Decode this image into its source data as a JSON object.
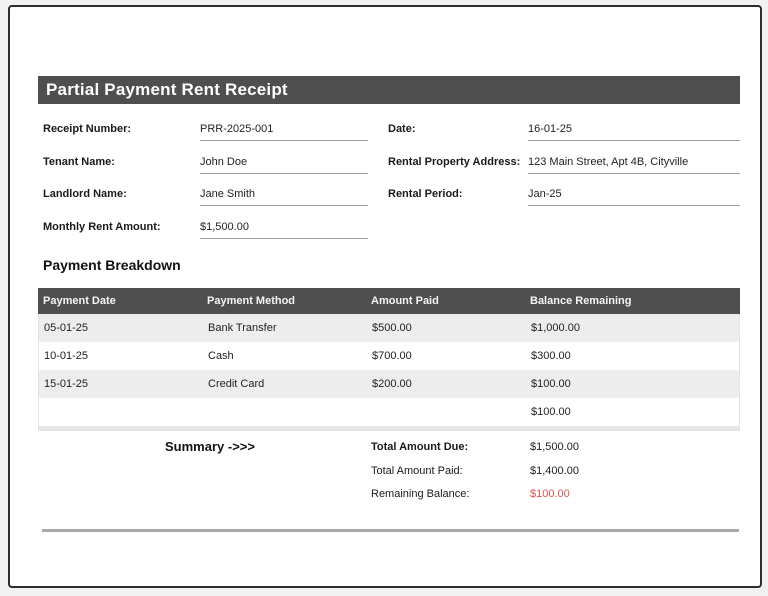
{
  "page": {
    "title": "Partial Payment Rent Receipt"
  },
  "fields": {
    "left": [
      {
        "label": "Receipt Number:",
        "value": "PRR-2025-001"
      },
      {
        "label": "Tenant Name:",
        "value": "John Doe"
      },
      {
        "label": "Landlord Name:",
        "value": "Jane Smith"
      },
      {
        "label": "Monthly Rent Amount:",
        "value": "$1,500.00"
      }
    ],
    "right": [
      {
        "label": "Date:",
        "value": "16-01-25"
      },
      {
        "label": "Rental Property Address:",
        "value": "123 Main Street, Apt 4B, Cityville"
      },
      {
        "label": "Rental Period:",
        "value": "Jan-25"
      }
    ]
  },
  "breakdown": {
    "heading": "Payment Breakdown",
    "columns": [
      "Payment Date",
      "Payment Method",
      "Amount Paid",
      "Balance Remaining"
    ],
    "rows": [
      [
        "05-01-25",
        "Bank Transfer",
        "$500.00",
        "$1,000.00"
      ],
      [
        "10-01-25",
        "Cash",
        "$700.00",
        "$300.00"
      ],
      [
        "15-01-25",
        "Credit Card",
        "$200.00",
        "$100.00"
      ],
      [
        "",
        "",
        "",
        "$100.00"
      ]
    ]
  },
  "summary": {
    "heading": "Summary ->>>",
    "rows": [
      {
        "label": "Total Amount Due:",
        "value": "$1,500.00"
      },
      {
        "label": "Total Amount Paid:",
        "value": "$1,400.00"
      },
      {
        "label": "Remaining Balance:",
        "value": "$100.00"
      }
    ]
  },
  "colors": {
    "header_bg": "#4f4f4f",
    "row_alt_bg": "#ededed",
    "highlight_red": "#d9534f",
    "underline": "#9b9b9b",
    "divider": "#a8a8a8",
    "frame_border": "#2d2d2d"
  }
}
